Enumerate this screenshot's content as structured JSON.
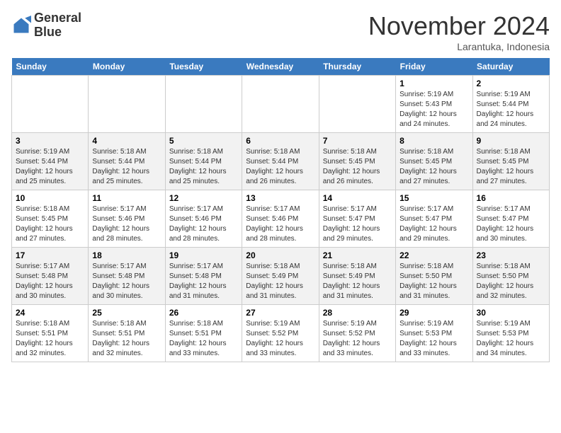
{
  "header": {
    "logo_line1": "General",
    "logo_line2": "Blue",
    "month_title": "November 2024",
    "location": "Larantuka, Indonesia"
  },
  "weekdays": [
    "Sunday",
    "Monday",
    "Tuesday",
    "Wednesday",
    "Thursday",
    "Friday",
    "Saturday"
  ],
  "weeks": [
    [
      {
        "day": "",
        "info": ""
      },
      {
        "day": "",
        "info": ""
      },
      {
        "day": "",
        "info": ""
      },
      {
        "day": "",
        "info": ""
      },
      {
        "day": "",
        "info": ""
      },
      {
        "day": "1",
        "info": "Sunrise: 5:19 AM\nSunset: 5:43 PM\nDaylight: 12 hours and 24 minutes."
      },
      {
        "day": "2",
        "info": "Sunrise: 5:19 AM\nSunset: 5:44 PM\nDaylight: 12 hours and 24 minutes."
      }
    ],
    [
      {
        "day": "3",
        "info": "Sunrise: 5:19 AM\nSunset: 5:44 PM\nDaylight: 12 hours and 25 minutes."
      },
      {
        "day": "4",
        "info": "Sunrise: 5:18 AM\nSunset: 5:44 PM\nDaylight: 12 hours and 25 minutes."
      },
      {
        "day": "5",
        "info": "Sunrise: 5:18 AM\nSunset: 5:44 PM\nDaylight: 12 hours and 25 minutes."
      },
      {
        "day": "6",
        "info": "Sunrise: 5:18 AM\nSunset: 5:44 PM\nDaylight: 12 hours and 26 minutes."
      },
      {
        "day": "7",
        "info": "Sunrise: 5:18 AM\nSunset: 5:45 PM\nDaylight: 12 hours and 26 minutes."
      },
      {
        "day": "8",
        "info": "Sunrise: 5:18 AM\nSunset: 5:45 PM\nDaylight: 12 hours and 27 minutes."
      },
      {
        "day": "9",
        "info": "Sunrise: 5:18 AM\nSunset: 5:45 PM\nDaylight: 12 hours and 27 minutes."
      }
    ],
    [
      {
        "day": "10",
        "info": "Sunrise: 5:18 AM\nSunset: 5:45 PM\nDaylight: 12 hours and 27 minutes."
      },
      {
        "day": "11",
        "info": "Sunrise: 5:17 AM\nSunset: 5:46 PM\nDaylight: 12 hours and 28 minutes."
      },
      {
        "day": "12",
        "info": "Sunrise: 5:17 AM\nSunset: 5:46 PM\nDaylight: 12 hours and 28 minutes."
      },
      {
        "day": "13",
        "info": "Sunrise: 5:17 AM\nSunset: 5:46 PM\nDaylight: 12 hours and 28 minutes."
      },
      {
        "day": "14",
        "info": "Sunrise: 5:17 AM\nSunset: 5:47 PM\nDaylight: 12 hours and 29 minutes."
      },
      {
        "day": "15",
        "info": "Sunrise: 5:17 AM\nSunset: 5:47 PM\nDaylight: 12 hours and 29 minutes."
      },
      {
        "day": "16",
        "info": "Sunrise: 5:17 AM\nSunset: 5:47 PM\nDaylight: 12 hours and 30 minutes."
      }
    ],
    [
      {
        "day": "17",
        "info": "Sunrise: 5:17 AM\nSunset: 5:48 PM\nDaylight: 12 hours and 30 minutes."
      },
      {
        "day": "18",
        "info": "Sunrise: 5:17 AM\nSunset: 5:48 PM\nDaylight: 12 hours and 30 minutes."
      },
      {
        "day": "19",
        "info": "Sunrise: 5:17 AM\nSunset: 5:48 PM\nDaylight: 12 hours and 31 minutes."
      },
      {
        "day": "20",
        "info": "Sunrise: 5:18 AM\nSunset: 5:49 PM\nDaylight: 12 hours and 31 minutes."
      },
      {
        "day": "21",
        "info": "Sunrise: 5:18 AM\nSunset: 5:49 PM\nDaylight: 12 hours and 31 minutes."
      },
      {
        "day": "22",
        "info": "Sunrise: 5:18 AM\nSunset: 5:50 PM\nDaylight: 12 hours and 31 minutes."
      },
      {
        "day": "23",
        "info": "Sunrise: 5:18 AM\nSunset: 5:50 PM\nDaylight: 12 hours and 32 minutes."
      }
    ],
    [
      {
        "day": "24",
        "info": "Sunrise: 5:18 AM\nSunset: 5:51 PM\nDaylight: 12 hours and 32 minutes."
      },
      {
        "day": "25",
        "info": "Sunrise: 5:18 AM\nSunset: 5:51 PM\nDaylight: 12 hours and 32 minutes."
      },
      {
        "day": "26",
        "info": "Sunrise: 5:18 AM\nSunset: 5:51 PM\nDaylight: 12 hours and 33 minutes."
      },
      {
        "day": "27",
        "info": "Sunrise: 5:19 AM\nSunset: 5:52 PM\nDaylight: 12 hours and 33 minutes."
      },
      {
        "day": "28",
        "info": "Sunrise: 5:19 AM\nSunset: 5:52 PM\nDaylight: 12 hours and 33 minutes."
      },
      {
        "day": "29",
        "info": "Sunrise: 5:19 AM\nSunset: 5:53 PM\nDaylight: 12 hours and 33 minutes."
      },
      {
        "day": "30",
        "info": "Sunrise: 5:19 AM\nSunset: 5:53 PM\nDaylight: 12 hours and 34 minutes."
      }
    ]
  ]
}
